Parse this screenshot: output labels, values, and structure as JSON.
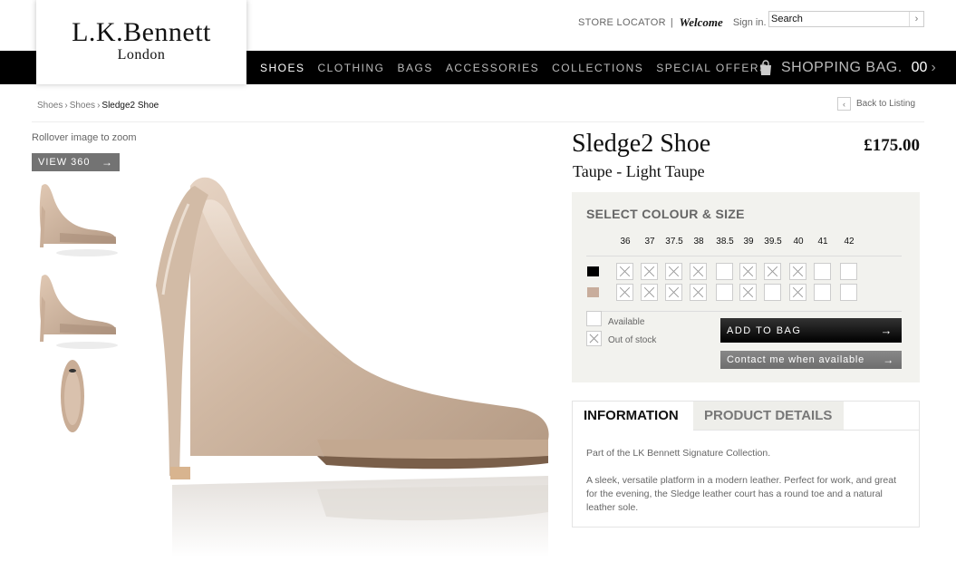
{
  "brand": {
    "name": "L.K.Bennett",
    "location": "London"
  },
  "header": {
    "store_locator": "STORE LOCATOR",
    "separator": "|",
    "welcome": "Welcome",
    "sign_in": "Sign in.",
    "search_value": "Search"
  },
  "nav": {
    "items": [
      "SHOES",
      "CLOTHING",
      "BAGS",
      "ACCESSORIES",
      "COLLECTIONS",
      "SPECIAL OFFERS"
    ],
    "active": "SHOES"
  },
  "bag": {
    "label": "SHOPPING BAG.",
    "count": "00"
  },
  "breadcrumb": [
    "Shoes",
    "Shoes",
    "Sledge2 Shoe"
  ],
  "back_label": "Back to Listing",
  "gallery": {
    "rollover_hint": "Rollover image to zoom",
    "view360_label": "VIEW 360"
  },
  "product": {
    "title": "Sledge2 Shoe",
    "colour_name": "Taupe - Light Taupe",
    "price": "£175.00"
  },
  "select": {
    "heading": "SELECT COLOUR & SIZE",
    "sizes": [
      "36",
      "37",
      "37.5",
      "38",
      "38.5",
      "39",
      "39.5",
      "40",
      "41",
      "42"
    ],
    "rows": [
      {
        "colour": "black",
        "hex": "#000000",
        "stock": [
          false,
          false,
          false,
          false,
          true,
          false,
          false,
          false,
          true,
          true
        ]
      },
      {
        "colour": "taupe",
        "hex": "#c8ad9c",
        "stock": [
          false,
          false,
          false,
          false,
          true,
          false,
          true,
          false,
          true,
          true
        ]
      }
    ],
    "legend_available": "Available",
    "legend_out": "Out of stock",
    "add_to_bag": "ADD TO BAG",
    "contact": "Contact me when available"
  },
  "info": {
    "tab_information": "INFORMATION",
    "tab_details": "PRODUCT DETAILS",
    "para1": "Part of the LK Bennett Signature Collection.",
    "para2": "A sleek, versatile platform in a modern leather. Perfect for work, and great for the evening, the Sledge leather court has a round toe and a natural leather sole."
  },
  "colors": {
    "nav_bg": "#000000",
    "panel_bg": "#f2f2ee",
    "button_dark": "#111111",
    "button_grey": "#777777"
  }
}
